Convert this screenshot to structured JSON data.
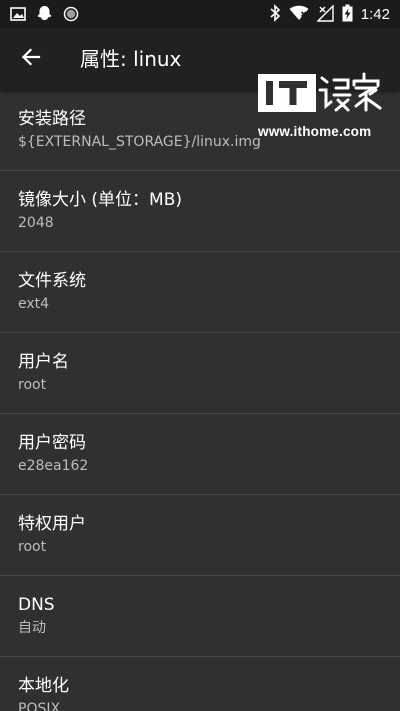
{
  "status_bar": {
    "time": "1:42",
    "left_icons": [
      "image-icon",
      "ghost-icon",
      "circle-icon"
    ],
    "right_icons": [
      "bluetooth-icon",
      "wifi-icon",
      "signal-icon",
      "battery-charging-icon"
    ]
  },
  "app_bar": {
    "title": "属性: linux",
    "back_icon": "arrow-back-icon"
  },
  "watermark": {
    "logo_text": "IT之家",
    "url": "www.ithome.com"
  },
  "settings": [
    {
      "label": "安装路径",
      "value": "${EXTERNAL_STORAGE}/linux.img"
    },
    {
      "label": "镜像大小 (单位：MB)",
      "value": "2048"
    },
    {
      "label": "文件系统",
      "value": "ext4"
    },
    {
      "label": "用户名",
      "value": "root"
    },
    {
      "label": "用户密码",
      "value": "e28ea162"
    },
    {
      "label": "特权用户",
      "value": "root"
    },
    {
      "label": "DNS",
      "value": "自动"
    },
    {
      "label": "本地化",
      "value": "POSIX"
    }
  ],
  "colors": {
    "background": "#303030",
    "app_bar": "#212121",
    "status_bar": "#1b1b1b",
    "divider": "#484848",
    "secondary_text": "#bdbdbd"
  }
}
